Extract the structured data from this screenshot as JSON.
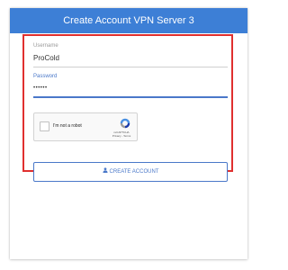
{
  "header": {
    "title": "Create Account VPN Server 3"
  },
  "form": {
    "username_label": "Username",
    "username_value": "ProCold",
    "password_label": "Password",
    "password_value": "••••••"
  },
  "recaptcha": {
    "label": "I'm not a robot",
    "brand": "reCAPTCHA",
    "links": "Privacy - Terms",
    "logo_icon": "recaptcha-logo-icon"
  },
  "actions": {
    "create_label": "CREATE ACCOUNT",
    "create_icon": "user-icon"
  },
  "colors": {
    "header_bg": "#3d7fd6",
    "accent": "#4a78c9",
    "highlight_border": "#e0302f"
  }
}
